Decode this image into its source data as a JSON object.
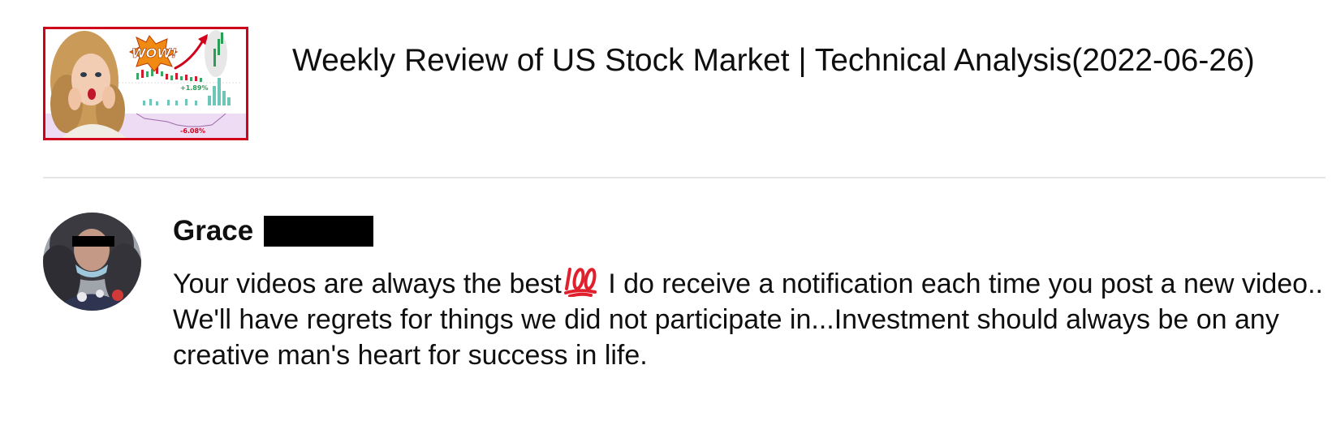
{
  "video": {
    "title": "Weekly Review of US Stock Market | Technical Analysis(2022-06-26)",
    "thumbnail": {
      "badge_text": "WOW!",
      "percent_up": "+1.89%",
      "percent_down": "-6.08%",
      "border_color": "#d0021b"
    }
  },
  "comment": {
    "author": {
      "name": "Grace",
      "surname_redacted": true
    },
    "text_before_emoji": "Your videos are always the best",
    "emoji": "hundred-points-icon",
    "text_after_emoji": " I do receive a notification each time you post a new video.. We'll have regrets for things we did not participate in...Investment should always be on any creative man's heart for success in life."
  },
  "colors": {
    "divider": "#e5e5e5",
    "text": "#0f0f0f",
    "emoji": "#e0202c"
  }
}
